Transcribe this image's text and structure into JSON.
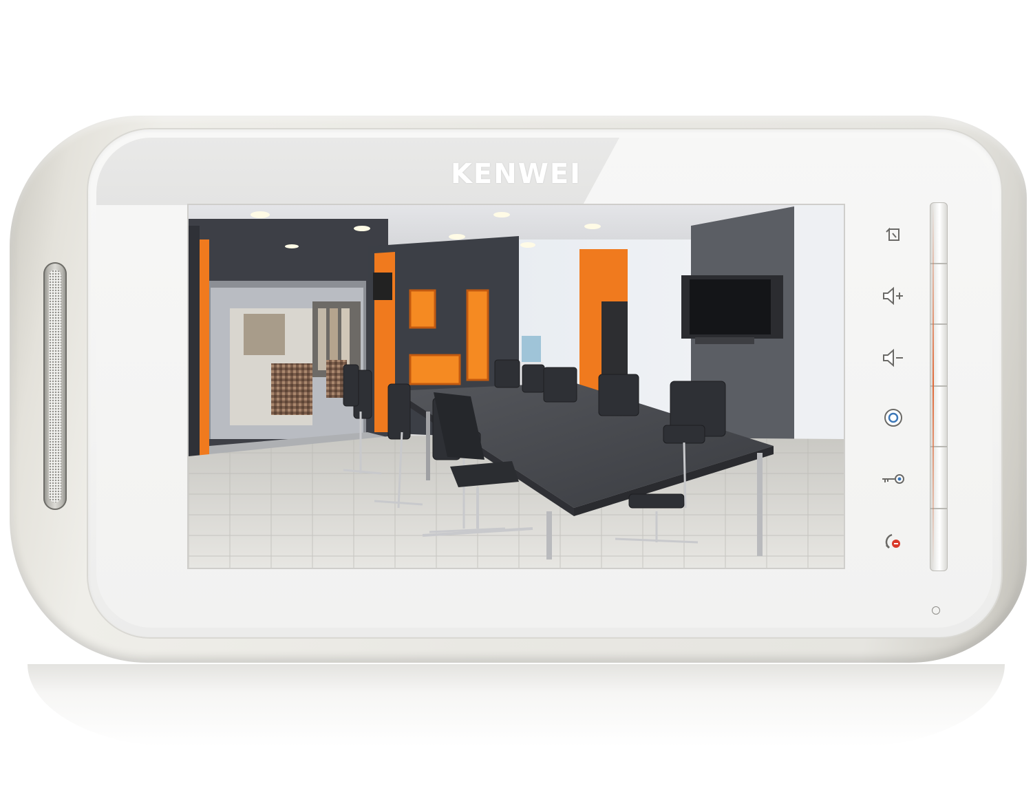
{
  "device": {
    "brand": "KENWEI"
  },
  "buttons": [
    {
      "name": "monitor-button",
      "icon": "monitor-icon"
    },
    {
      "name": "volume-up-button",
      "icon": "volume-up-icon"
    },
    {
      "name": "volume-down-button",
      "icon": "volume-down-icon"
    },
    {
      "name": "settings-button",
      "icon": "target-icon"
    },
    {
      "name": "unlock-button",
      "icon": "key-icon"
    },
    {
      "name": "hang-up-button",
      "icon": "phone-hangup-icon"
    }
  ],
  "colors": {
    "accent": "#e06a3a",
    "bezel": "#f4f4f3",
    "shell": "#e6e5e0",
    "wall_orange": "#f07a1e",
    "wall_dark": "#3c3f46"
  }
}
